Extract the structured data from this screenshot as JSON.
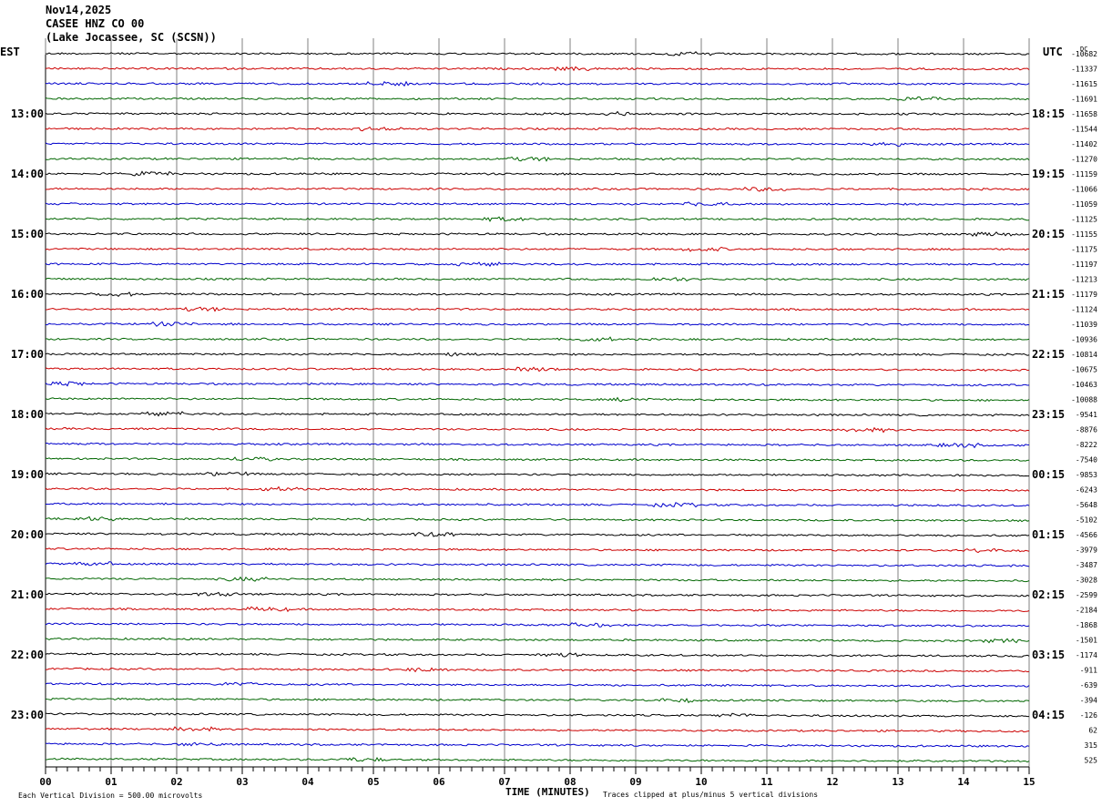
{
  "header": {
    "date": "Nov14,2025",
    "station": "CASEE HNZ CO 00",
    "location": "(Lake Jocassee, SC (SCSN))"
  },
  "left_timezone": "EST",
  "right_timezone": "UTC",
  "dc_label": "DC",
  "footer": {
    "scale_note": "Each Vertical Division =  500.00 microvolts",
    "xlabel": "TIME (MINUTES)",
    "clip_note": "Traces clipped at plus/minus 5 vertical divisions"
  },
  "colors": {
    "trace_cycle": [
      "#000000",
      "#cc0000",
      "#0000cc",
      "#006600"
    ],
    "grid": "#808080"
  },
  "chart_data": {
    "type": "line",
    "title": "CASEE HNZ CO 00 (Lake Jocassee, SC (SCSN))",
    "xlabel": "TIME (MINUTES)",
    "xlim": [
      0,
      15
    ],
    "x_ticks": [
      "00",
      "01",
      "02",
      "03",
      "04",
      "05",
      "06",
      "07",
      "08",
      "09",
      "10",
      "11",
      "12",
      "13",
      "14",
      "15"
    ],
    "grid": true,
    "rows": 48,
    "left_labels": [
      {
        "row": 4,
        "text": "13:00"
      },
      {
        "row": 8,
        "text": "14:00"
      },
      {
        "row": 12,
        "text": "15:00"
      },
      {
        "row": 16,
        "text": "16:00"
      },
      {
        "row": 20,
        "text": "17:00"
      },
      {
        "row": 24,
        "text": "18:00"
      },
      {
        "row": 28,
        "text": "19:00"
      },
      {
        "row": 32,
        "text": "20:00"
      },
      {
        "row": 36,
        "text": "21:00"
      },
      {
        "row": 40,
        "text": "22:00"
      },
      {
        "row": 44,
        "text": "23:00"
      }
    ],
    "right_labels": [
      {
        "row": 4,
        "text": "18:15"
      },
      {
        "row": 8,
        "text": "19:15"
      },
      {
        "row": 12,
        "text": "20:15"
      },
      {
        "row": 16,
        "text": "21:15"
      },
      {
        "row": 20,
        "text": "22:15"
      },
      {
        "row": 24,
        "text": "23:15"
      },
      {
        "row": 28,
        "text": "00:15"
      },
      {
        "row": 32,
        "text": "01:15"
      },
      {
        "row": 36,
        "text": "02:15"
      },
      {
        "row": 40,
        "text": "03:15"
      },
      {
        "row": 44,
        "text": "04:15"
      }
    ],
    "dc_offsets": [
      "-10682",
      "-11337",
      "-11615",
      "-11691",
      "-11658",
      "-11544",
      "-11402",
      "-11270",
      "-11159",
      "-11066",
      "-11059",
      "-11125",
      "-11155",
      "-11175",
      "-11197",
      "-11213",
      "-11179",
      "-11124",
      "-11039",
      "-10936",
      "-10814",
      "-10675",
      "-10463",
      "-10088",
      "-9541",
      "-8876",
      "-8222",
      "-7540",
      "-9853",
      "-6243",
      "-5648",
      "-5102",
      "-4566",
      "-3979",
      "-3487",
      "-3028",
      "-2599",
      "-2184",
      "-1868",
      "-1501",
      "-1174",
      "-911",
      "-639",
      "-394",
      "-126",
      "62",
      "315",
      "525"
    ]
  }
}
